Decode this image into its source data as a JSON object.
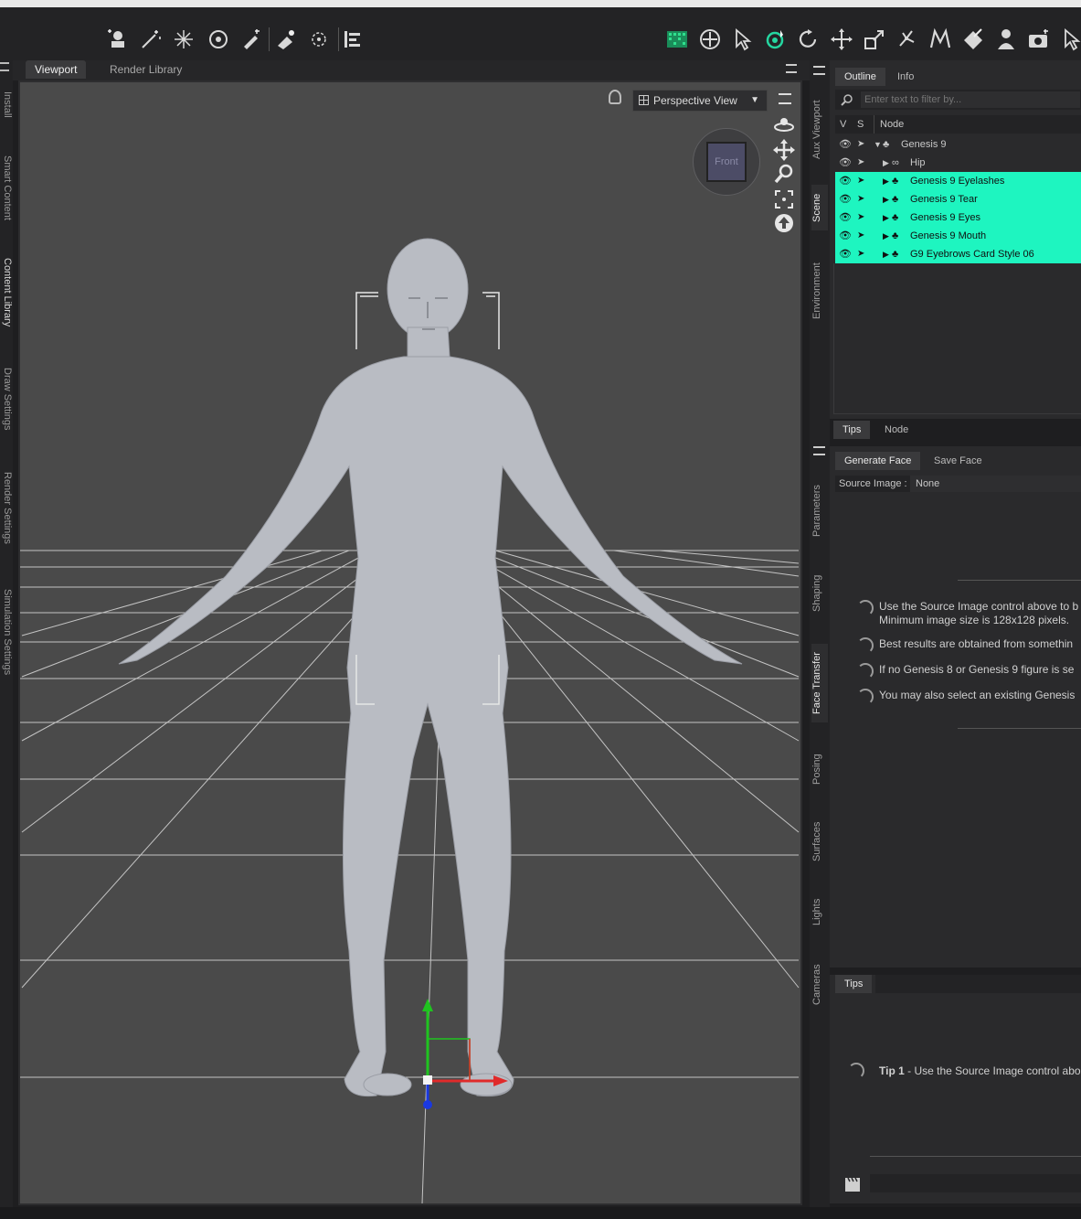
{
  "viewport_tabs": [
    "Viewport",
    "Render Library"
  ],
  "left_tabs": [
    "Install",
    "Smart Content",
    "Content Library",
    "Draw Settings",
    "Render Settings",
    "Simulation Settings"
  ],
  "view_dropdown": "Perspective View",
  "gizmo_label": "Front",
  "mid_tabs": [
    "Aux Viewport",
    "Scene",
    "Environment",
    "Parameters",
    "Shaping",
    "Face Transfer",
    "Posing",
    "Surfaces",
    "Lights",
    "Cameras"
  ],
  "scene": {
    "tabs": [
      "Outline",
      "Info"
    ],
    "filter_placeholder": "Enter text to filter by...",
    "columns": [
      "V",
      "S",
      "Node"
    ],
    "nodes": [
      {
        "label": "Genesis 9",
        "selected": false
      },
      {
        "label": "Hip",
        "selected": false
      },
      {
        "label": "Genesis 9 Eyelashes",
        "selected": true
      },
      {
        "label": "Genesis 9 Tear",
        "selected": true
      },
      {
        "label": "Genesis 9 Eyes",
        "selected": true
      },
      {
        "label": "Genesis 9 Mouth",
        "selected": true
      },
      {
        "label": "G9 Eyebrows Card Style 06",
        "selected": true
      }
    ],
    "bottom_tabs": [
      "Tips",
      "Node"
    ]
  },
  "face_transfer": {
    "tabs": [
      "Generate Face",
      "Save Face"
    ],
    "source_label": "Source Image :",
    "source_value": "None",
    "tips": [
      "Use the Source Image control above to b",
      "Minimum image size is 128x128 pixels.",
      "Best results are obtained from somethin",
      "If no Genesis 8 or Genesis 9 figure is se",
      "You may also select an existing Genesis"
    ]
  },
  "tips_panel": {
    "tab": "Tips",
    "tip_bold": "Tip 1",
    "tip_text": " - Use the Source Image control abo"
  },
  "colors": {
    "selection": "#1ef5c0",
    "accent_green": "#25d6a0"
  }
}
